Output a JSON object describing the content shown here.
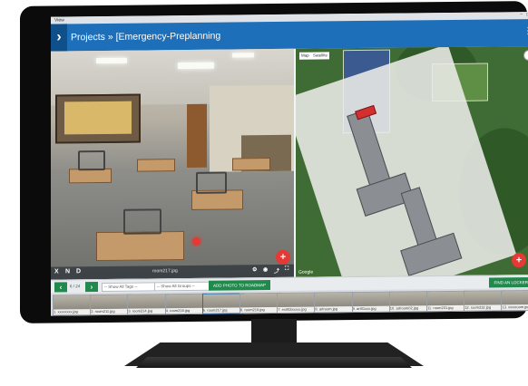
{
  "window": {
    "title": "View"
  },
  "appbar": {
    "menu_glyph": "›",
    "breadcrumb": "Projects » [Emergency-Preplanning",
    "more_glyph": "⋮"
  },
  "panorama": {
    "toolbar": {
      "close_label": "X",
      "next_label": "N",
      "delete_label": "D"
    },
    "filename": "room217.jpg",
    "fab_glyph": "+"
  },
  "map": {
    "map_type": "Map",
    "satellite_type": "Satellite",
    "zoom_in": "+",
    "zoom_out": "−",
    "attribution": "Google",
    "fab_glyph": "+"
  },
  "controls": {
    "prev": "‹",
    "next": "›",
    "counter": "6 / 24",
    "tags_select": "-- Show All Tags --",
    "groups_select": "-- Show All Groups --",
    "add_button": "ADD PHOTO TO ROADMAP",
    "lock_button": "FIND AN LOCKER"
  },
  "thumbnails": [
    {
      "label": "1. xxxxxxxx.jpg"
    },
    {
      "label": "2. room211.jpg"
    },
    {
      "label": "3. room214.jpg"
    },
    {
      "label": "4. room216.jpg"
    },
    {
      "label": "5. room217.jpg"
    },
    {
      "label": "6. room219.jpg"
    },
    {
      "label": "7. exit02xxxxx.jpg"
    },
    {
      "label": "8. artroom.jpg"
    },
    {
      "label": "9. art01xxx.jpg"
    },
    {
      "label": "10. artroom02.jpg"
    },
    {
      "label": "11. room231.jpg"
    },
    {
      "label": "12. room232.jpg"
    },
    {
      "label": "13. xxxxroom.jpg"
    }
  ],
  "colors": {
    "appbar": "#1e6fb9",
    "accent_green": "#1f8a4c",
    "fab_red": "#e53935"
  }
}
